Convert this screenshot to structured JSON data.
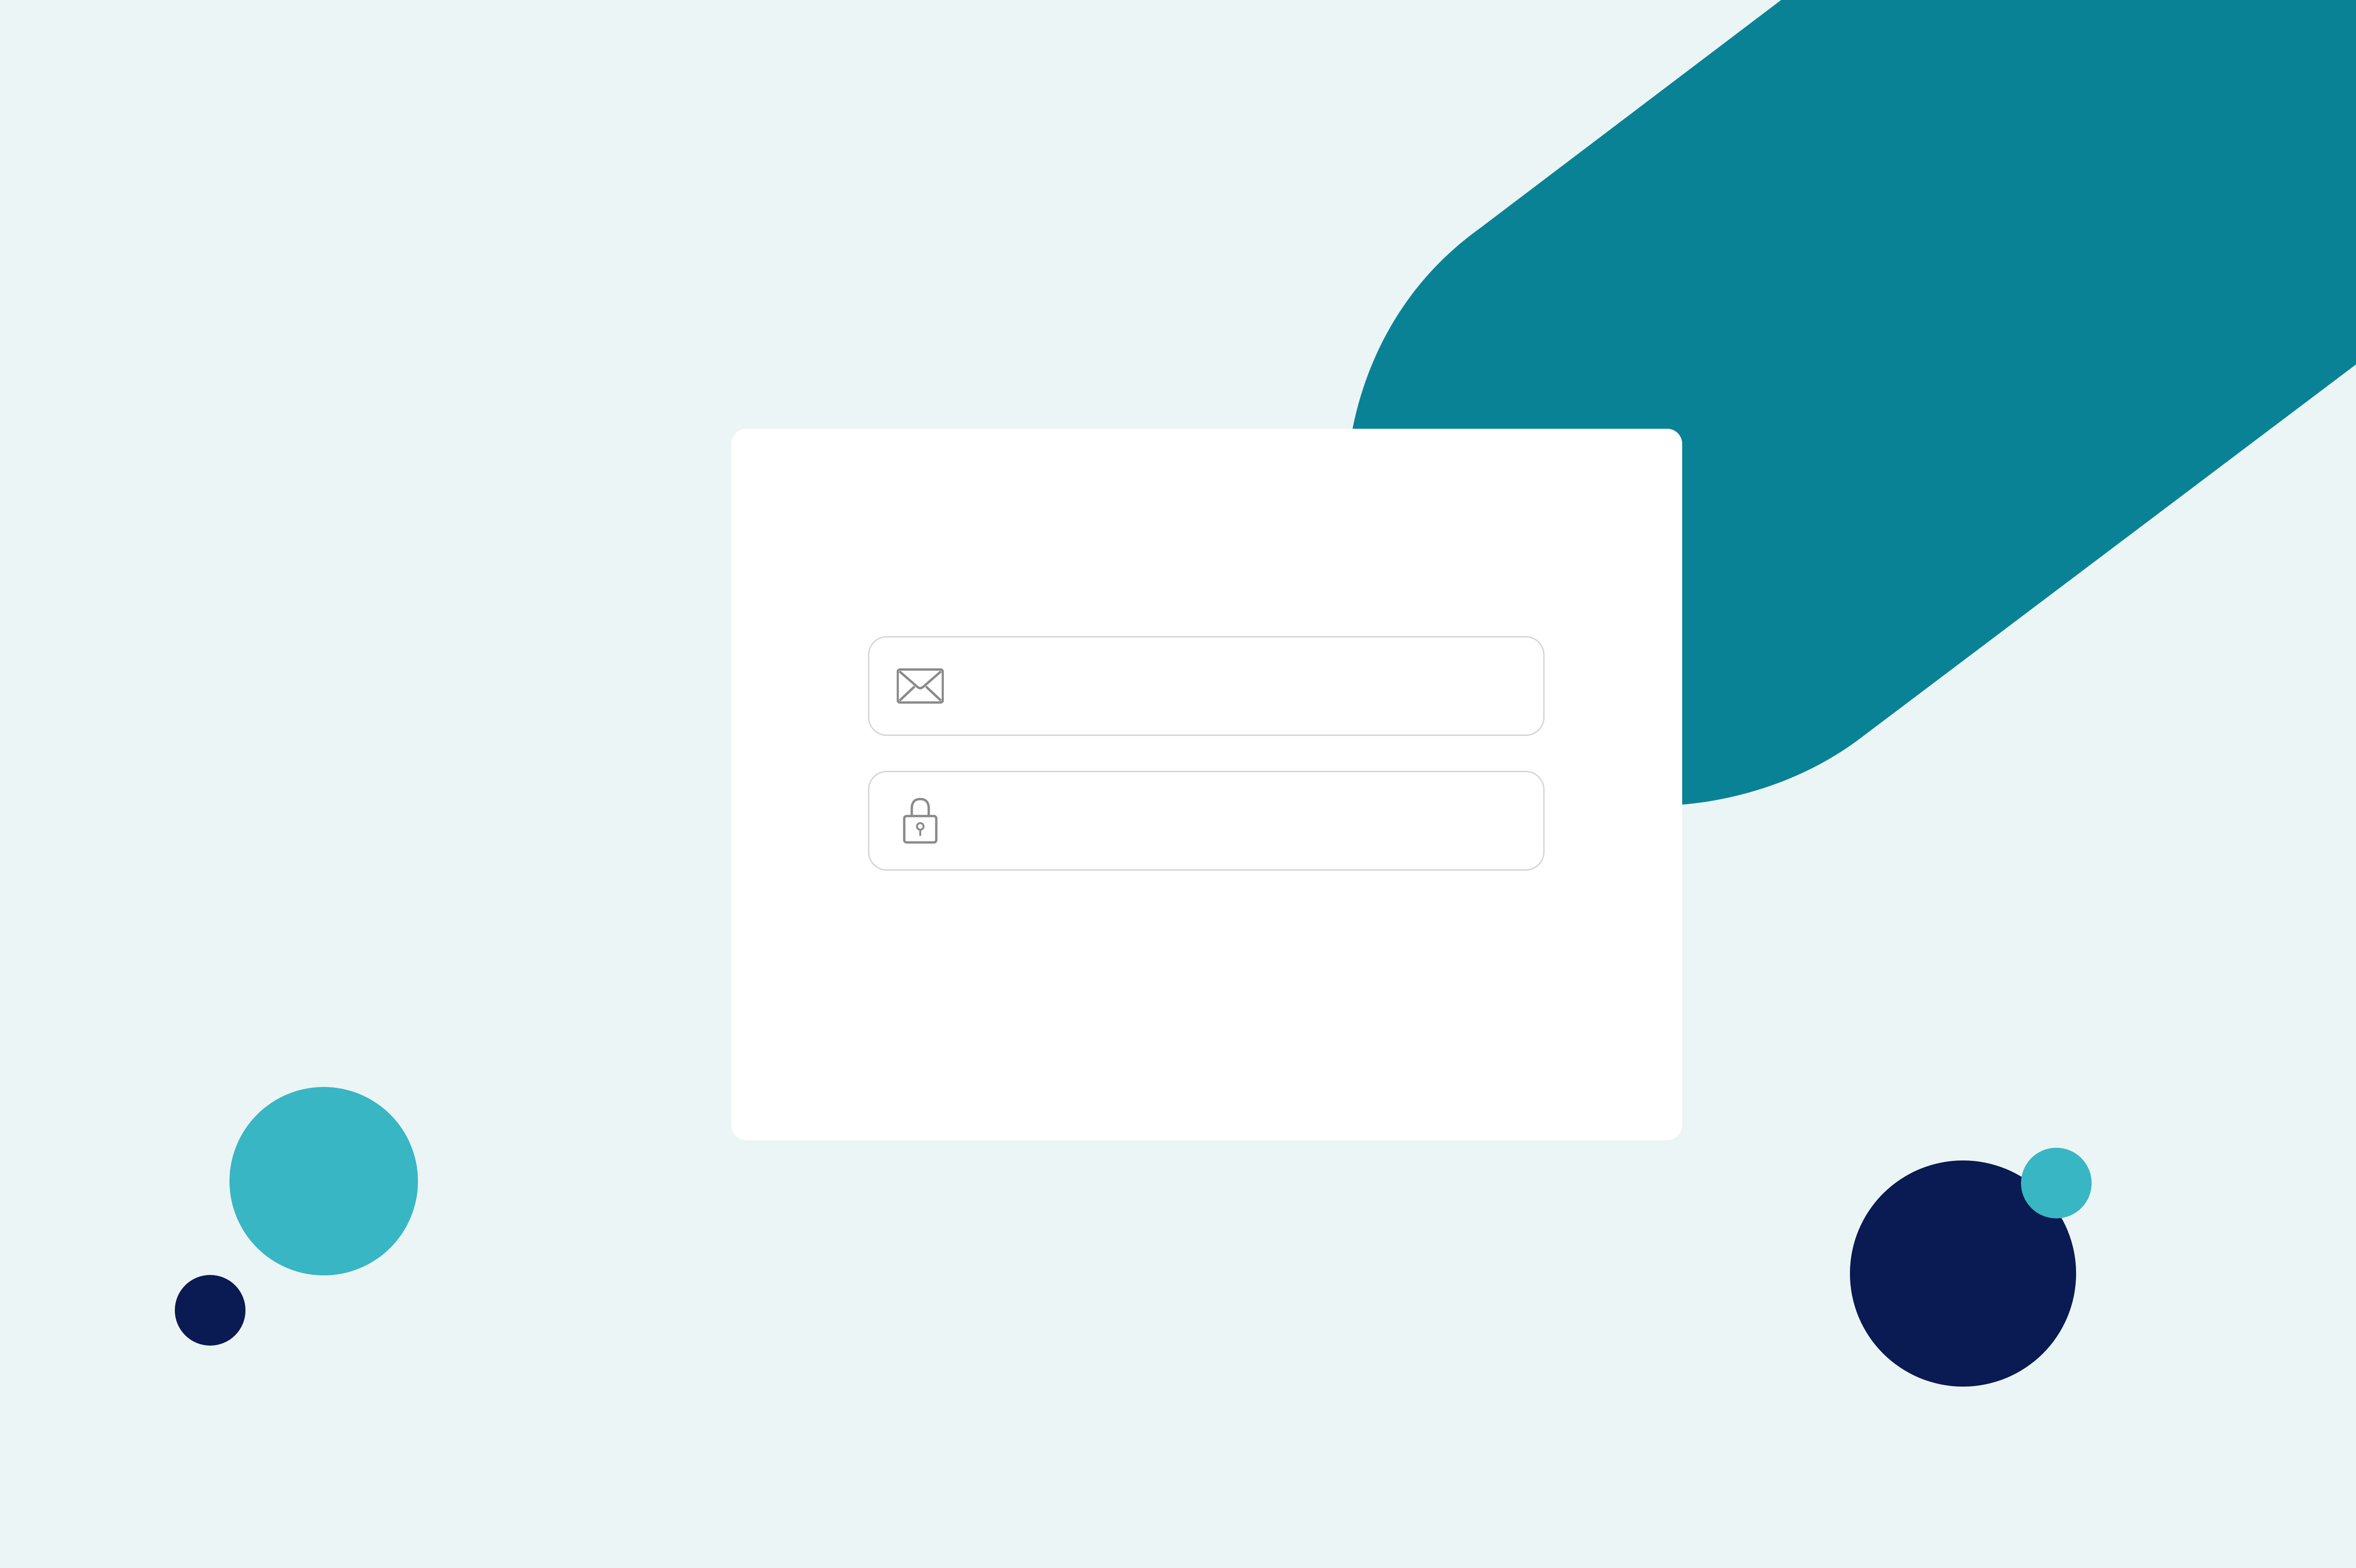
{
  "colors": {
    "background": "#ebf5f5",
    "teal_dark": "#0a8296",
    "teal_light": "#38b6c4",
    "navy": "#0a1a52",
    "card": "#ffffff",
    "field_border": "#d6d6d6",
    "icon_stroke": "#8a8a8a"
  },
  "login_form": {
    "email": {
      "icon": "envelope-icon",
      "placeholder": "",
      "value": ""
    },
    "password": {
      "icon": "lock-icon",
      "placeholder": "",
      "value": ""
    }
  }
}
